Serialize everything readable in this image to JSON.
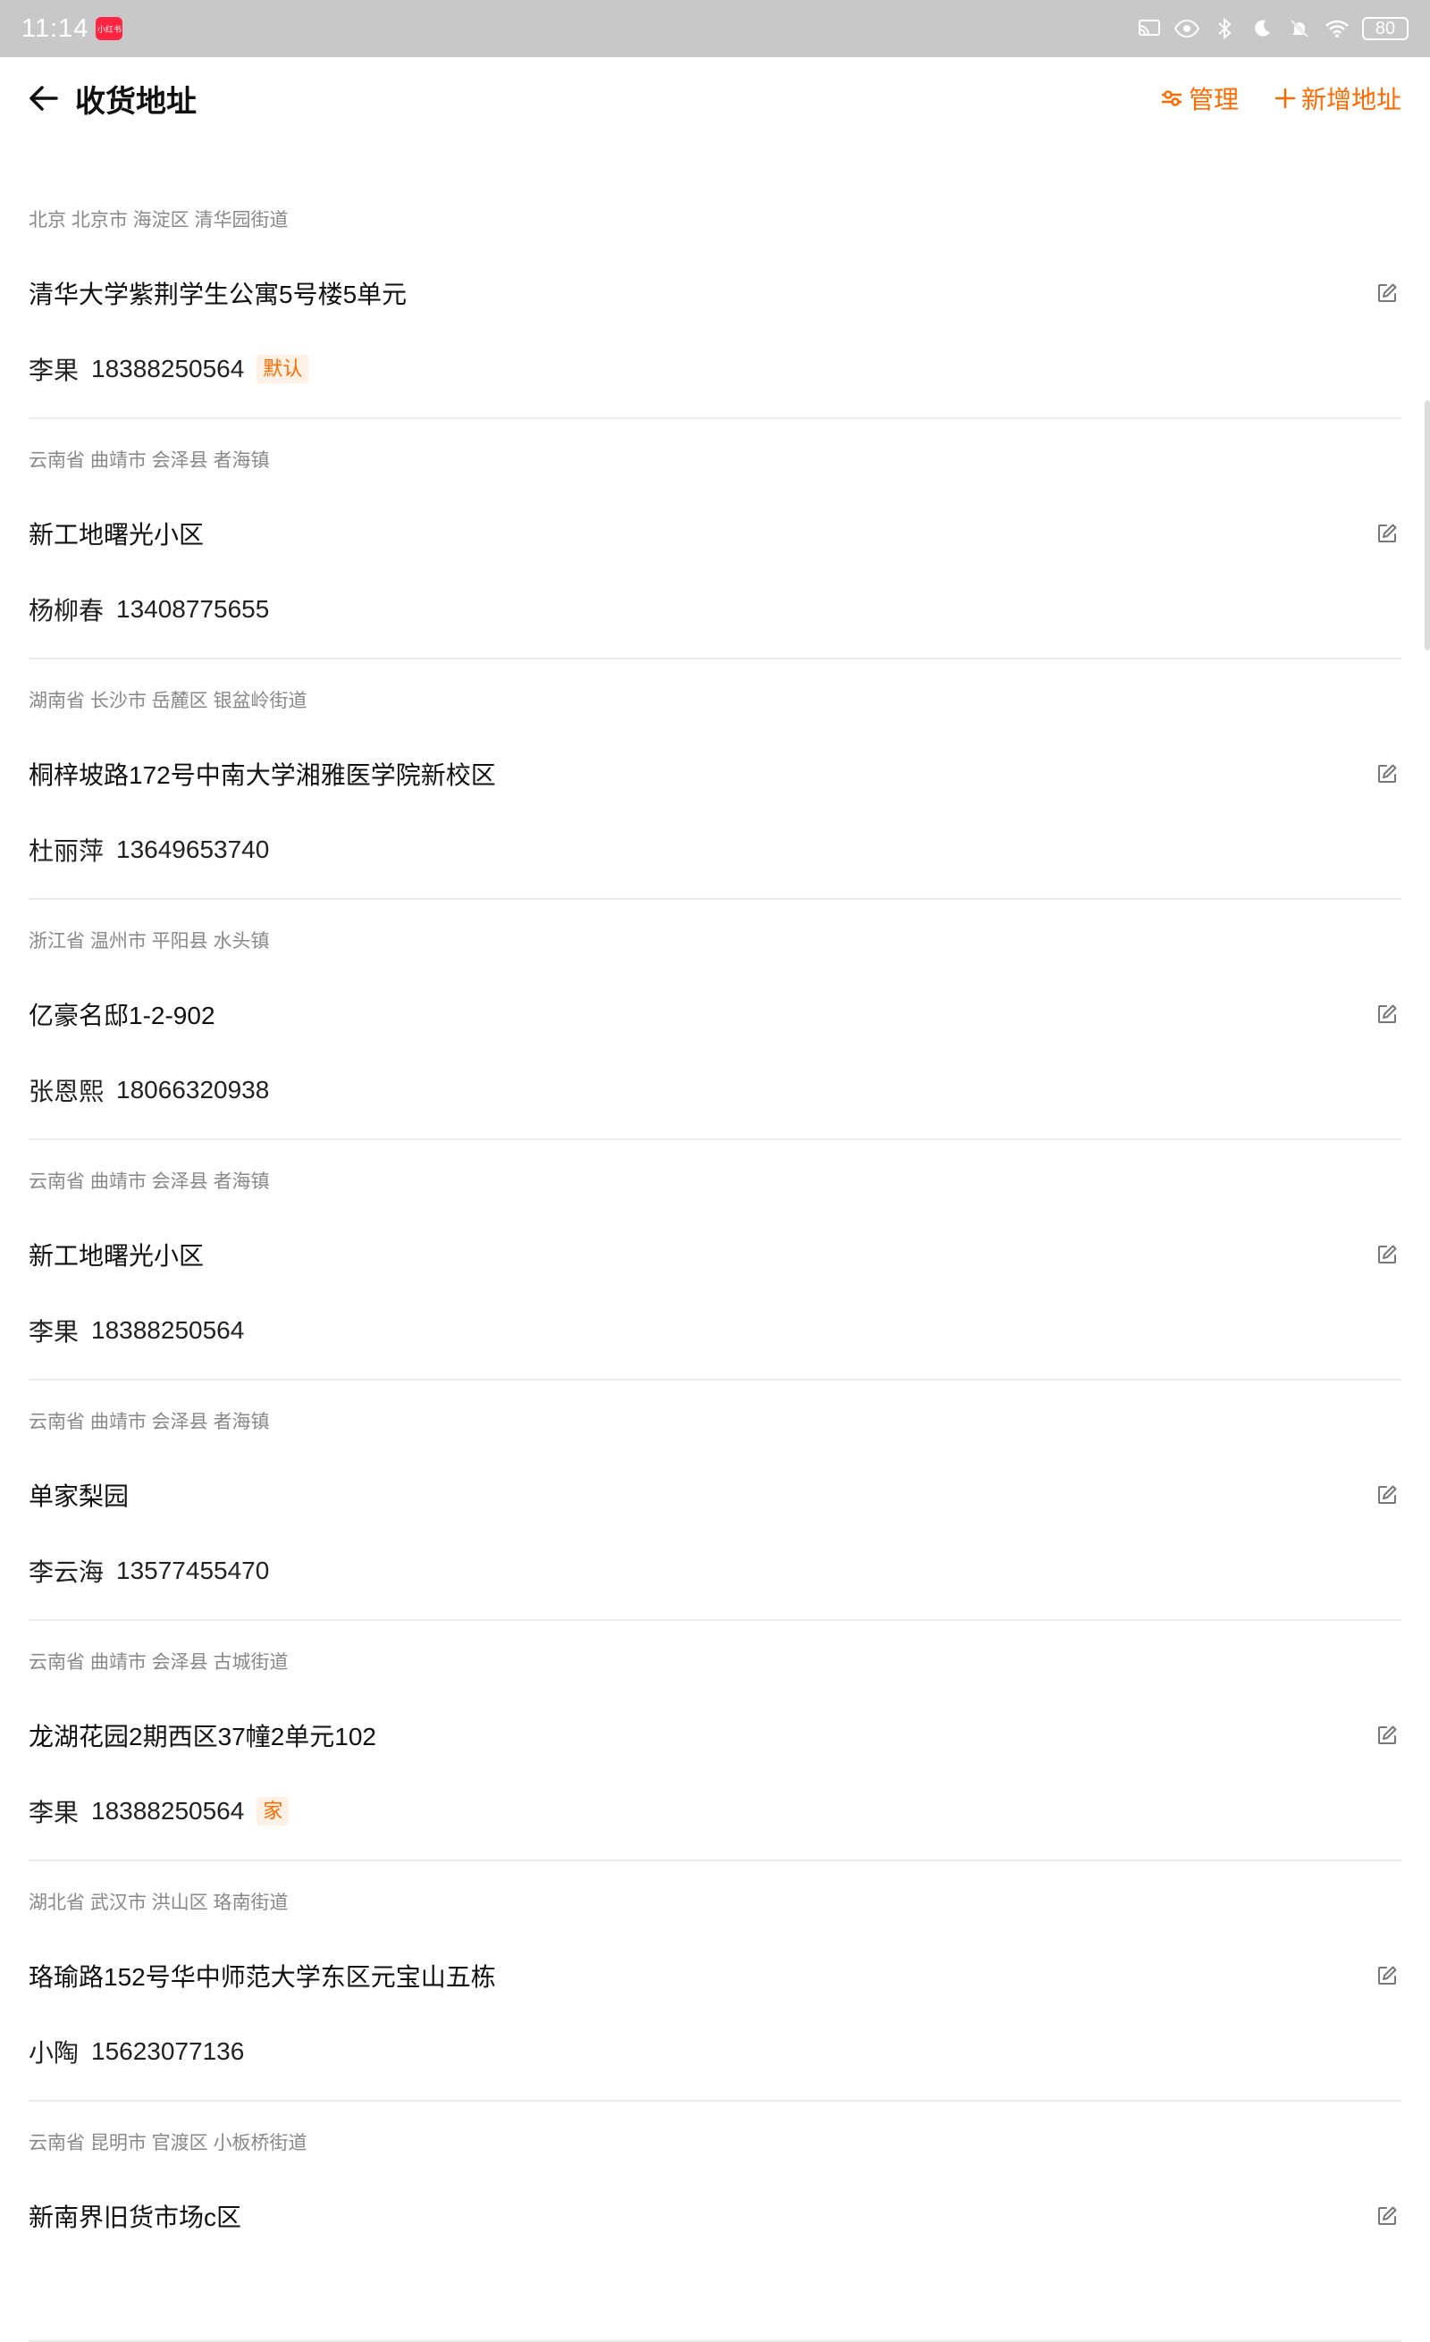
{
  "status": {
    "time": "11:14",
    "app_badge": "小红书",
    "battery": "80"
  },
  "header": {
    "title": "收货地址",
    "manage_label": "管理",
    "add_label": "新增地址"
  },
  "colors": {
    "accent": "#ff6a00",
    "tag_bg": "#fff1e6",
    "region_text": "#888888",
    "divider": "#ececec"
  },
  "addresses": [
    {
      "region": "北京 北京市 海淀区 清华园街道",
      "detail": "清华大学紫荆学生公寓5号楼5单元",
      "name": "李果",
      "phone": "18388250564",
      "tag": "默认"
    },
    {
      "region": "云南省 曲靖市 会泽县 者海镇",
      "detail": "新工地曙光小区",
      "name": "杨柳春",
      "phone": "13408775655",
      "tag": ""
    },
    {
      "region": "湖南省 长沙市 岳麓区 银盆岭街道",
      "detail": "桐梓坡路172号中南大学湘雅医学院新校区",
      "name": "杜丽萍",
      "phone": "13649653740",
      "tag": ""
    },
    {
      "region": "浙江省 温州市 平阳县 水头镇",
      "detail": "亿豪名邸1-2-902",
      "name": "张恩熙",
      "phone": "18066320938",
      "tag": ""
    },
    {
      "region": "云南省 曲靖市 会泽县 者海镇",
      "detail": "新工地曙光小区",
      "name": "李果",
      "phone": "18388250564",
      "tag": ""
    },
    {
      "region": "云南省 曲靖市 会泽县 者海镇",
      "detail": "单家梨园",
      "name": "李云海",
      "phone": "13577455470",
      "tag": ""
    },
    {
      "region": "云南省 曲靖市 会泽县 古城街道",
      "detail": "龙湖花园2期西区37幢2单元102",
      "name": "李果",
      "phone": "18388250564",
      "tag": "家"
    },
    {
      "region": "湖北省 武汉市 洪山区 珞南街道",
      "detail": "珞瑜路152号华中师范大学东区元宝山五栋",
      "name": "小陶",
      "phone": "15623077136",
      "tag": ""
    },
    {
      "region": "云南省 昆明市 官渡区 小板桥街道",
      "detail": "新南界旧货市场c区",
      "name": "",
      "phone": "",
      "tag": ""
    }
  ]
}
